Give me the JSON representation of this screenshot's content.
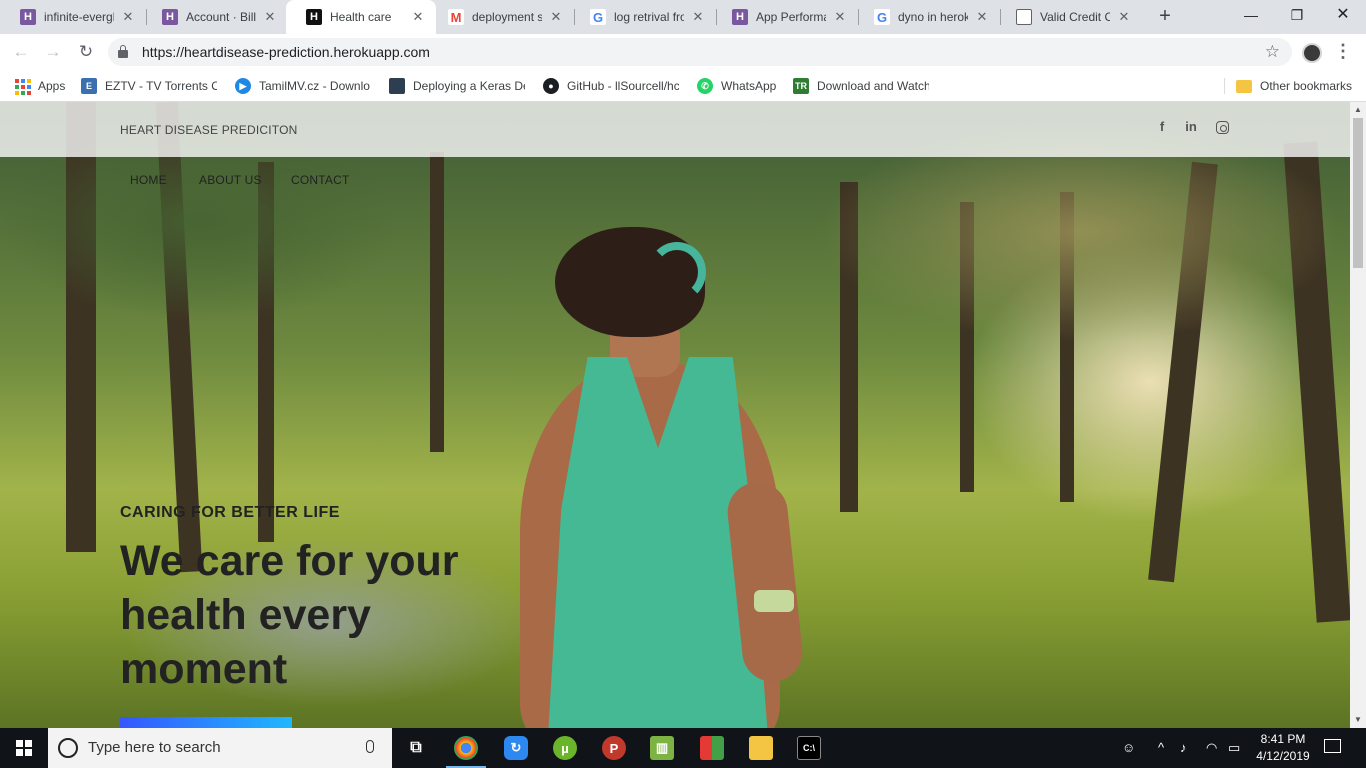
{
  "browser": {
    "tabs": [
      {
        "title": "infinite-evergla",
        "icon_letter": "H",
        "icon_color": "#79589f",
        "active": false
      },
      {
        "title": "Account · Billin",
        "icon_letter": "H",
        "icon_color": "#79589f",
        "active": false
      },
      {
        "title": "Health care",
        "icon_letter": "H",
        "icon_color": "#111111",
        "active": true
      },
      {
        "title": "deployment sc",
        "icon_letter": "M",
        "icon_color": "#ea4335",
        "active": false
      },
      {
        "title": "log retrival fro",
        "icon_letter": "G",
        "icon_color": "#4285f4",
        "active": false
      },
      {
        "title": "App Performan",
        "icon_letter": "H",
        "icon_color": "#79589f",
        "active": false
      },
      {
        "title": "dyno in heroku",
        "icon_letter": "G",
        "icon_color": "#4285f4",
        "active": false
      },
      {
        "title": "Valid Credit Ca",
        "icon_letter": "",
        "icon_color": "#ffffff",
        "active": false
      }
    ],
    "url": "https://heartdisease-prediction.herokuapp.com",
    "bookmarks": [
      {
        "label": "Apps",
        "icon_color": "#4285f4"
      },
      {
        "label": "EZTV - TV Torrents O",
        "icon_color": "#3a6fb0"
      },
      {
        "label": "TamilMV.cz - Downlo",
        "icon_color": "#1e88e5"
      },
      {
        "label": "Deploying a Keras De",
        "icon_color": "#2c3e50"
      },
      {
        "label": "GitHub - llSourcell/hc",
        "icon_color": "#1b1f23"
      },
      {
        "label": "WhatsApp",
        "icon_color": "#25d366"
      },
      {
        "label": "Download and Watch",
        "icon_color": "#2e7d32"
      }
    ],
    "other_bookmarks": "Other bookmarks"
  },
  "site": {
    "brand": "HEART DISEASE PREDICITON",
    "nav": [
      "HOME",
      "ABOUT US",
      "CONTACT"
    ],
    "social": [
      "facebook-icon",
      "linkedin-icon",
      "instagram-icon"
    ],
    "hero": {
      "kicker": "CARING FOR BETTER LIFE",
      "headline": "We care for your health every moment"
    }
  },
  "taskbar": {
    "search_placeholder": "Type here to search",
    "time": "8:41 PM",
    "date": "4/12/2019"
  }
}
